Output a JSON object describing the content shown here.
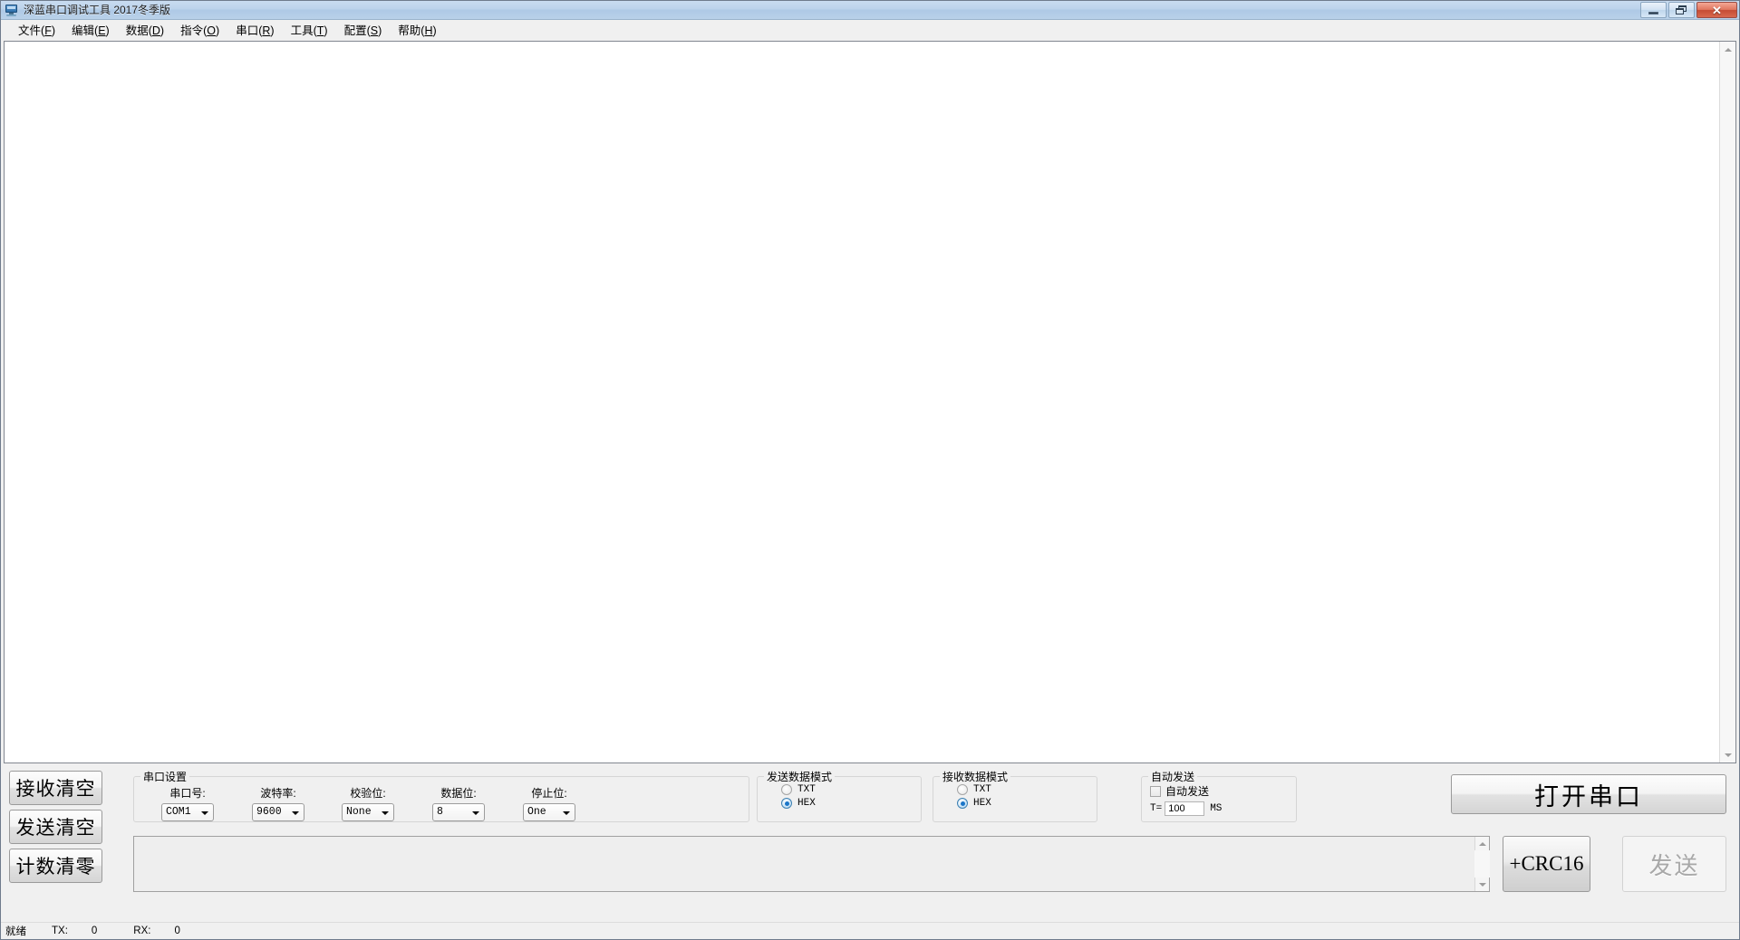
{
  "window": {
    "title": "深蓝串口调试工具 2017冬季版",
    "icon": "monitor-icon",
    "controls": {
      "minimize": "minimize-icon",
      "maximize": "restore-icon",
      "close": "✕"
    }
  },
  "menubar": {
    "items": [
      {
        "text": "文件",
        "accel": "F"
      },
      {
        "text": "编辑",
        "accel": "E"
      },
      {
        "text": "数据",
        "accel": "D"
      },
      {
        "text": "指令",
        "accel": "O"
      },
      {
        "text": "串口",
        "accel": "R"
      },
      {
        "text": "工具",
        "accel": "T"
      },
      {
        "text": "配置",
        "accel": "S"
      },
      {
        "text": "帮助",
        "accel": "H"
      }
    ]
  },
  "receive_area": {
    "content": "",
    "scrollbar": "vertical-scrollbar"
  },
  "left_buttons": [
    {
      "label": "接收清空",
      "name": "clear-receive-button"
    },
    {
      "label": "发送清空",
      "name": "clear-send-button"
    },
    {
      "label": "计数清零",
      "name": "reset-counter-button"
    }
  ],
  "serial_settings": {
    "group_title": "串口设置",
    "fields": [
      {
        "label": "串口号:",
        "value": "COM1"
      },
      {
        "label": "波特率:",
        "value": "9600"
      },
      {
        "label": "校验位:",
        "value": "None"
      },
      {
        "label": "数据位:",
        "value": "8"
      },
      {
        "label": "停止位:",
        "value": "One"
      }
    ]
  },
  "send_mode": {
    "group_title": "发送数据模式",
    "options": [
      {
        "label": "TXT",
        "checked": false
      },
      {
        "label": "HEX",
        "checked": true
      }
    ]
  },
  "receive_mode": {
    "group_title": "接收数据模式",
    "options": [
      {
        "label": "TXT",
        "checked": false
      },
      {
        "label": "HEX",
        "checked": true
      }
    ]
  },
  "auto_send": {
    "group_title": "自动发送",
    "checkbox_label": "自动发送",
    "checked": false,
    "t_label": "T=",
    "t_value": "100",
    "unit": "MS"
  },
  "send_area": {
    "content": "",
    "placeholder": ""
  },
  "actions": {
    "open_port": "打开串口",
    "crc": "+CRC16",
    "send": "发送",
    "send_disabled": true
  },
  "statusbar": {
    "ready": "就绪",
    "tx_label": "TX:",
    "tx_value": "0",
    "rx_label": "RX:",
    "rx_value": "0"
  },
  "colors": {
    "titlebar": "#bcd3eb",
    "face": "#f0f0f0",
    "accent": "#1b76c8",
    "close": "#c54c34",
    "disabled_text": "#a8a8a8"
  }
}
